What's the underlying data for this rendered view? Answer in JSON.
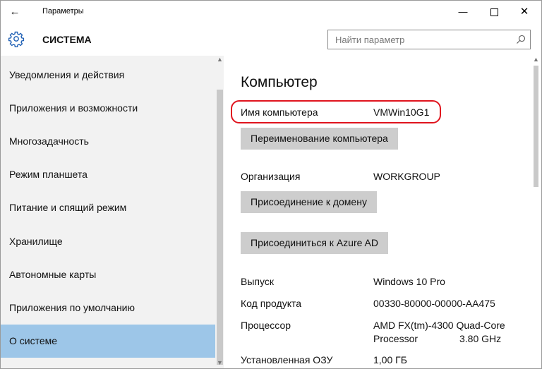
{
  "window": {
    "title": "Параметры"
  },
  "header": {
    "title": "СИСТЕМА",
    "search_placeholder": "Найти параметр"
  },
  "sidebar": {
    "items": [
      {
        "label": "Уведомления и действия"
      },
      {
        "label": "Приложения и возможности"
      },
      {
        "label": "Многозадачность"
      },
      {
        "label": "Режим планшета"
      },
      {
        "label": "Питание и спящий режим"
      },
      {
        "label": "Хранилище"
      },
      {
        "label": "Автономные карты"
      },
      {
        "label": "Приложения по умолчанию"
      },
      {
        "label": "О системе"
      }
    ],
    "selected": "О системе"
  },
  "main": {
    "title": "Компьютер",
    "computer_name_label": "Имя компьютера",
    "computer_name_value": "VMWin10G1",
    "rename_button": "Переименование компьютера",
    "organization_label": "Организация",
    "organization_value": "WORKGROUP",
    "join_domain_button": "Присоединение к домену",
    "join_azure_button": "Присоединиться к Azure AD",
    "edition_label": "Выпуск",
    "edition_value": "Windows 10 Pro",
    "product_code_label": "Код продукта",
    "product_code_value": "00330-80000-00000-AA475",
    "processor_label": "Процессор",
    "processor_value_line1": "AMD FX(tm)-4300 Quad-Core",
    "processor_value_line2": "Processor",
    "processor_speed": "3.80 GHz",
    "ram_label": "Установленная ОЗУ",
    "ram_value": "1,00 ГБ"
  },
  "colors": {
    "selected_bg": "#9dc6e8",
    "highlight_border": "#e0141e",
    "button_bg": "#cdcdcd"
  },
  "icons": {
    "back": "back-arrow-icon",
    "gear": "gear-icon",
    "search": "search-icon"
  }
}
